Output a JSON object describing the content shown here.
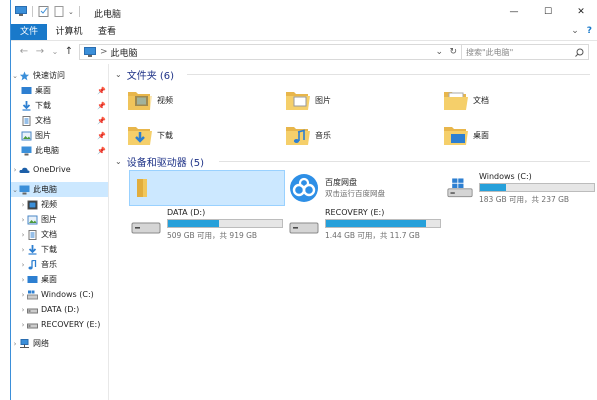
{
  "window": {
    "title": "此电脑",
    "controls": {
      "minimize": "—",
      "maximize": "☐",
      "close": "✕"
    }
  },
  "ribbon": {
    "tabs": [
      {
        "label": "文件",
        "active": true
      },
      {
        "label": "计算机",
        "active": false
      },
      {
        "label": "查看",
        "active": false
      }
    ],
    "collapse": "⌄",
    "help": "?"
  },
  "address": {
    "path_root": "此电脑",
    "separator": ">",
    "dropdown": "⌄",
    "refresh": "↻",
    "search_placeholder": "搜索\"此电脑\"",
    "search_icon": "search-icon"
  },
  "nav": {
    "back": "←",
    "forward": "→",
    "recent": "⌄",
    "up": "↑",
    "items": [
      {
        "label": "快速访问",
        "icon": "star-icon"
      },
      {
        "label": "桌面",
        "icon": "desktop-icon",
        "pinned": true
      },
      {
        "label": "下载",
        "icon": "download-icon",
        "pinned": true
      },
      {
        "label": "文档",
        "icon": "document-icon",
        "pinned": true
      },
      {
        "label": "图片",
        "icon": "picture-icon",
        "pinned": true
      },
      {
        "label": "此电脑",
        "icon": "computer-icon",
        "pinned": true
      },
      {
        "label": "OneDrive",
        "icon": "cloud-icon"
      },
      {
        "label": "此电脑",
        "icon": "computer-icon",
        "selected": true
      },
      {
        "label": "视频",
        "icon": "video-icon"
      },
      {
        "label": "图片",
        "icon": "picture-icon"
      },
      {
        "label": "文档",
        "icon": "document-icon"
      },
      {
        "label": "下载",
        "icon": "download-icon"
      },
      {
        "label": "音乐",
        "icon": "music-icon"
      },
      {
        "label": "桌面",
        "icon": "desktop-icon"
      },
      {
        "label": "Windows (C:)",
        "icon": "windows-drive-icon"
      },
      {
        "label": "DATA (D:)",
        "icon": "drive-icon"
      },
      {
        "label": "RECOVERY (E:)",
        "icon": "drive-icon"
      },
      {
        "label": "网络",
        "icon": "network-icon"
      }
    ]
  },
  "content": {
    "folders_header": "文件夹 (6)",
    "folders": [
      {
        "label": "视频",
        "icon": "video-folder-icon"
      },
      {
        "label": "图片",
        "icon": "picture-folder-icon"
      },
      {
        "label": "文档",
        "icon": "document-folder-icon"
      },
      {
        "label": "下载",
        "icon": "download-folder-icon"
      },
      {
        "label": "音乐",
        "icon": "music-folder-icon"
      },
      {
        "label": "桌面",
        "icon": "desktop-folder-icon"
      }
    ],
    "devices_header": "设备和驱动器 (5)",
    "devices": [
      {
        "name": "百度网盘",
        "sub": "双击运行百度网盘"
      },
      {
        "name": "Windows (C:)",
        "free": "183 GB 可用，共 237 GB",
        "used_fraction": 0.23
      },
      {
        "name": "DATA (D:)",
        "free": "509 GB 可用，共 919 GB",
        "used_fraction": 0.45
      },
      {
        "name": "RECOVERY (E:)",
        "free": "1.44 GB 可用，共 11.7 GB",
        "used_fraction": 0.88
      }
    ]
  },
  "colors": {
    "accent": "#1979ca",
    "selection": "#cce8ff",
    "header_text": "#1e3287",
    "drive_bar": "#26a0da"
  }
}
